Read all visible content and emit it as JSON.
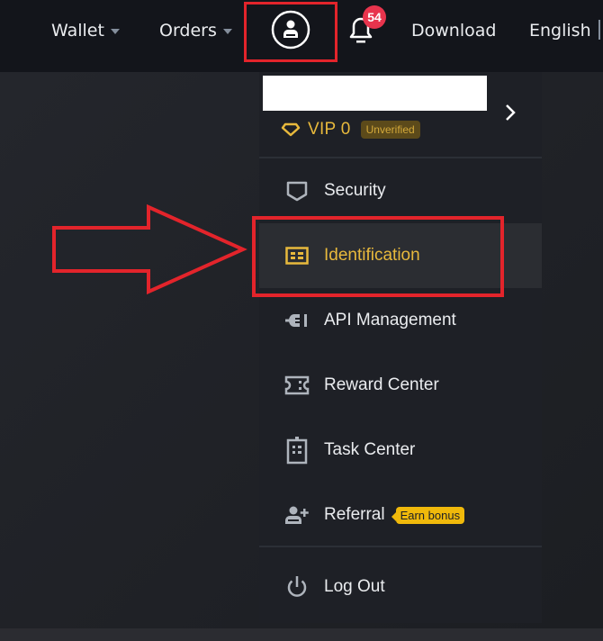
{
  "header": {
    "nav": [
      {
        "label": "Wallet",
        "has_caret": true
      },
      {
        "label": "Orders",
        "has_caret": true
      }
    ],
    "user_icon": "user-circle-icon",
    "notifications": {
      "icon": "bell-icon",
      "count": "54"
    },
    "download_label": "Download",
    "language_label": "English"
  },
  "dropdown": {
    "profile": {
      "name_redacted": true,
      "vip_label": "VIP 0",
      "vip_icon": "diamond-icon",
      "verification_badge": "Unverified",
      "chevron": "chevron-right-icon"
    },
    "items": [
      {
        "label": "Security",
        "icon": "shield-icon",
        "hovered": false
      },
      {
        "label": "Identification",
        "icon": "id-card-icon",
        "hovered": true
      },
      {
        "label": "API Management",
        "icon": "plug-icon",
        "hovered": false
      },
      {
        "label": "Reward Center",
        "icon": "ticket-icon",
        "hovered": false
      },
      {
        "label": "Task Center",
        "icon": "clipboard-icon",
        "hovered": false
      },
      {
        "label": "Referral",
        "icon": "user-plus-icon",
        "hovered": false,
        "badge": "Earn bonus"
      }
    ],
    "logout": {
      "label": "Log Out",
      "icon": "power-icon"
    }
  },
  "colors": {
    "accent_yellow": "#f0b90b",
    "annotation_red": "#e3242b",
    "badge_red": "#e8344d",
    "header_bg": "#13151b",
    "menu_bg": "#1e2026"
  }
}
